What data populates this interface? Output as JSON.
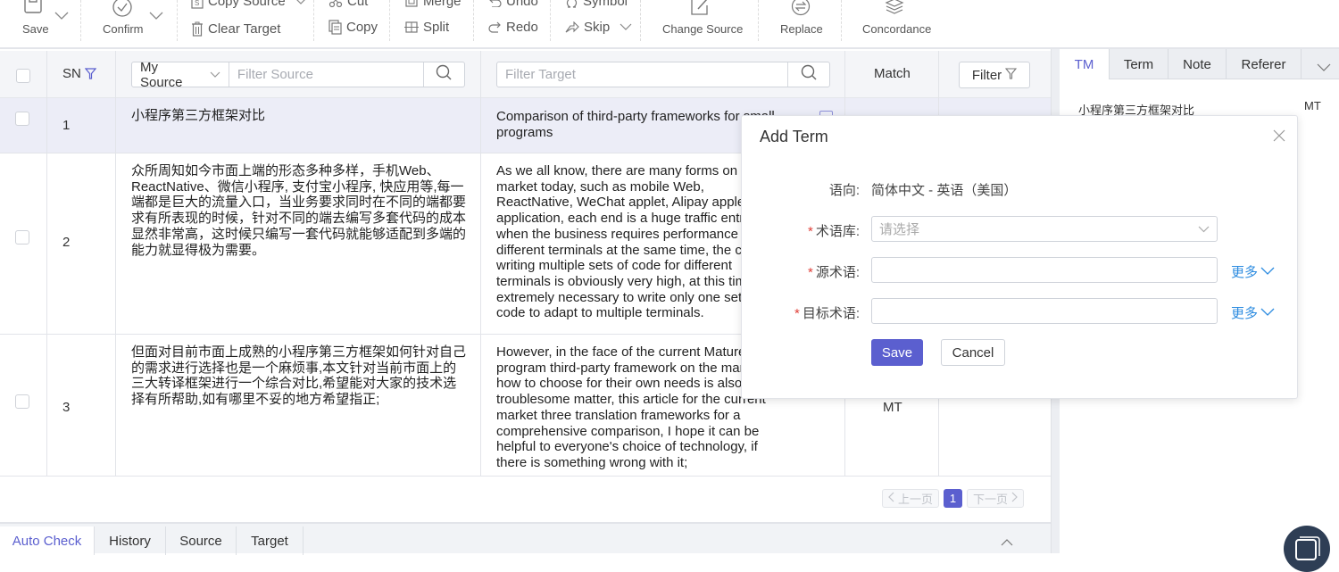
{
  "toolbar": {
    "save_label": "Save",
    "confirm_label": "Confirm",
    "copy_source_label": "Copy Source",
    "clear_target_label": "Clear Target",
    "cut_label": "Cut",
    "copy_label": "Copy",
    "merge_label": "Merge",
    "split_label": "Split",
    "undo_label": "Undo",
    "redo_label": "Redo",
    "symbol_label": "Symbol",
    "skip_label": "Skip",
    "change_source_label": "Change Source",
    "replace_label": "Replace",
    "concordance_label": "Concordance"
  },
  "grid": {
    "header": {
      "sn_label": "SN",
      "source_selector": "My Source",
      "filter_source_placeholder": "Filter Source",
      "filter_target_placeholder": "Filter Target",
      "match_label": "Match",
      "filter_label": "Filter"
    },
    "rows": [
      {
        "sn": "1",
        "source": "小程序第三方框架对比",
        "target": "Comparison of third-party frameworks for small programs",
        "match": "",
        "selected": true
      },
      {
        "sn": "2",
        "source": "众所周知如今市面上端的形态多种多样，手机Web、ReactNative、微信小程序, 支付宝小程序, 快应用等,每一端都是巨大的流量入口，当业务要求同时在不同的端都要求有所表现的时候，针对不同的端去编写多套代码的成本显然非常高，这时候只编写一套代码就能够适配到多端的能力就显得极为需要。",
        "target": "As we all know, there are many forms on the market today, such as mobile Web, ReactNative, WeChat applet, Alipay applet, fast application, each end is a huge traffic entrance, when the business requires performance on different terminals at the same time, the cost of writing multiple sets of code for different terminals is obviously very high, at this time, it is extremely necessary to write only one set of code to adapt to multiple terminals.",
        "match": ""
      },
      {
        "sn": "3",
        "source": "但面对目前市面上成熟的小程序第三方框架如何针对自己的需求进行选择也是一个麻烦事,本文针对当前市面上的三大转译框架进行一个综合对比,希望能对大家的技术选择有所帮助,如有哪里不妥的地方希望指正;",
        "target": "However, in the face of the current Mature small program third-party framework on the market how to choose for their own needs is also a troublesome matter, this article for the current market three translation frameworks for a comprehensive comparison, I hope it can be helpful to everyone's choice of technology, if there is something wrong with it;",
        "match": "MT"
      }
    ],
    "pagination": {
      "prev_label": "上一页",
      "current_page": "1",
      "next_label": "下一页"
    }
  },
  "bottom_tabs": [
    {
      "label": "Auto Check",
      "active": true
    },
    {
      "label": "History"
    },
    {
      "label": "Source"
    },
    {
      "label": "Target"
    }
  ],
  "side_panel": {
    "tabs": [
      {
        "label": "TM",
        "active": true
      },
      {
        "label": "Term"
      },
      {
        "label": "Note"
      },
      {
        "label": "Referer"
      }
    ],
    "tm_entry": {
      "source": "小程序第三方框架对比",
      "origin": "MT"
    }
  },
  "add_term_dialog": {
    "title": "Add Term",
    "language_label": "语向:",
    "language_value": "简体中文 - 英语（美国）",
    "termbase_label": "术语库:",
    "termbase_placeholder": "请选择",
    "source_term_label": "源术语:",
    "source_term_value": "",
    "target_term_label": "目标术语:",
    "target_term_value": "",
    "more_label": "更多",
    "save_label": "Save",
    "cancel_label": "Cancel"
  },
  "colors": {
    "accent": "#5b5fcf",
    "link": "#2d8ce0",
    "required": "#e0413a",
    "selected_row": "#ecedf7",
    "fab": "#2e3e55"
  }
}
